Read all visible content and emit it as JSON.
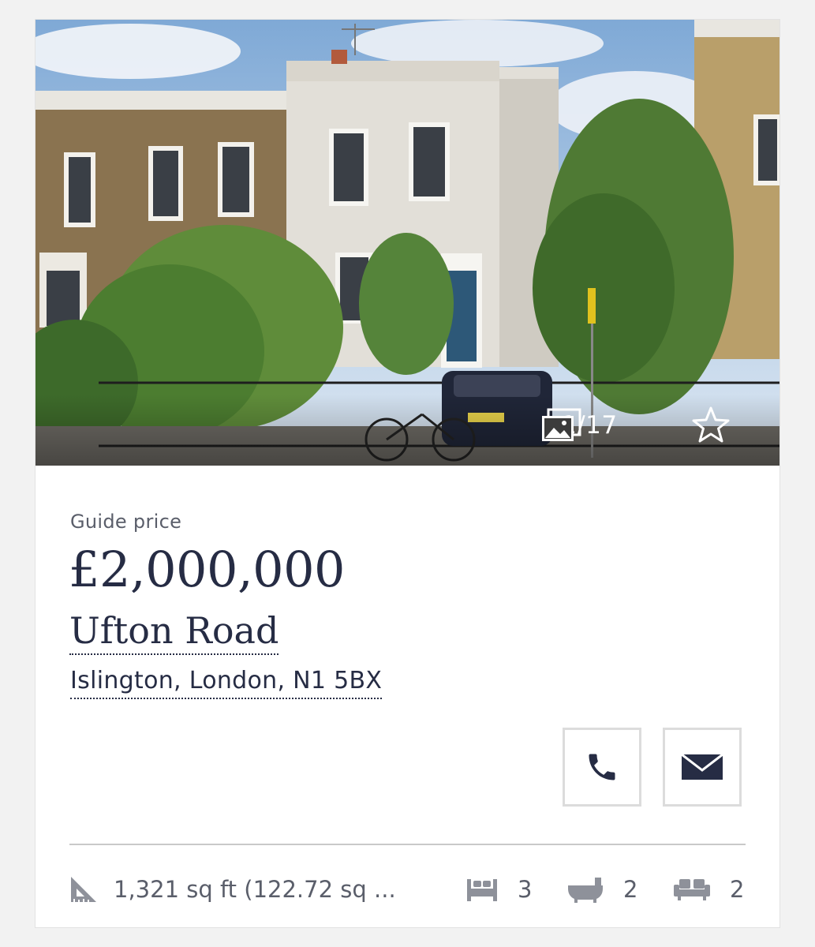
{
  "listing": {
    "gallery": {
      "counter": "1/17"
    },
    "price_label": "Guide price",
    "price": "£2,000,000",
    "street": "Ufton Road",
    "locality": "Islington, London, N1 5BX",
    "stats": {
      "area": "1,321 sq ft (122.72 sq ...",
      "bedrooms": "3",
      "bathrooms": "2",
      "receptions": "2"
    }
  },
  "icons": {
    "gallery": "image-gallery-icon",
    "favourite": "star-outline-icon",
    "call": "phone-icon",
    "email": "envelope-icon",
    "area": "set-square-icon",
    "bedrooms": "bed-icon",
    "bathrooms": "bathtub-icon",
    "receptions": "sofa-icon"
  },
  "colors": {
    "primary_text": "#262c44",
    "secondary_text": "#5a5e6a",
    "button_border": "#dcdcdc",
    "page_background": "#f2f2f2"
  }
}
